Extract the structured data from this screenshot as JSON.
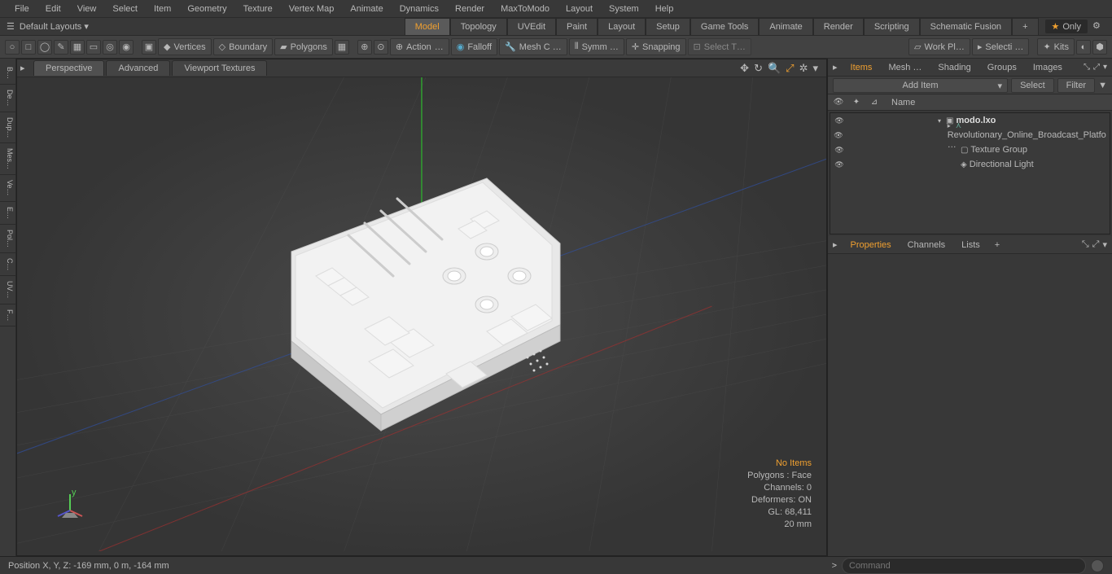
{
  "menu": [
    "File",
    "Edit",
    "View",
    "Select",
    "Item",
    "Geometry",
    "Texture",
    "Vertex Map",
    "Animate",
    "Dynamics",
    "Render",
    "MaxToModo",
    "Layout",
    "System",
    "Help"
  ],
  "layout": {
    "default": "Default Layouts",
    "tabs": [
      "Model",
      "Topology",
      "UVEdit",
      "Paint",
      "Layout",
      "Setup",
      "Game Tools",
      "Animate",
      "Render",
      "Scripting",
      "Schematic Fusion"
    ],
    "only": "Only"
  },
  "toolbar": {
    "vertices": "Vertices",
    "boundary": "Boundary",
    "polygons": "Polygons",
    "action": "Action",
    "falloff": "Falloff",
    "meshc": "Mesh C …",
    "symm": "Symm …",
    "snapping": "Snapping",
    "selectt": "Select T…",
    "workpl": "Work Pl…",
    "selecti": "Selecti …",
    "kits": "Kits"
  },
  "sidetools": [
    "B…",
    "De…",
    "Dup…",
    "Mes…",
    "Ve…",
    "E…",
    "Pol…",
    "C…",
    "UV…",
    "F…"
  ],
  "viewport": {
    "tabs": [
      "Perspective",
      "Advanced",
      "Viewport Textures"
    ],
    "info": {
      "noitems": "No Items",
      "polygons": "Polygons : Face",
      "channels": "Channels: 0",
      "deformers": "Deformers: ON",
      "gl": "GL: 68,411",
      "unit": "20 mm"
    }
  },
  "items_panel": {
    "tabs": [
      "Items",
      "Mesh …",
      "Shading",
      "Groups",
      "Images"
    ],
    "additem": "Add Item",
    "select": "Select",
    "filter": "Filter",
    "name_header": "Name",
    "tree": [
      {
        "label": "modo.lxo",
        "bold": true,
        "indent": 0,
        "expander": "▾",
        "icon": "▣"
      },
      {
        "label": "Revolutionary_Online_Broadcast_Platfo …",
        "indent": 1,
        "expander": "▸",
        "icon": "⋏"
      },
      {
        "label": "Texture Group",
        "indent": 1,
        "expander": "",
        "icon": "▢"
      },
      {
        "label": "Directional Light",
        "indent": 1,
        "expander": "",
        "icon": "◈"
      }
    ]
  },
  "props_panel": {
    "tabs": [
      "Properties",
      "Channels",
      "Lists"
    ]
  },
  "status": {
    "pos": "Position X, Y, Z:    -169 mm, 0 m, -164 mm",
    "cmd_placeholder": "Command"
  }
}
